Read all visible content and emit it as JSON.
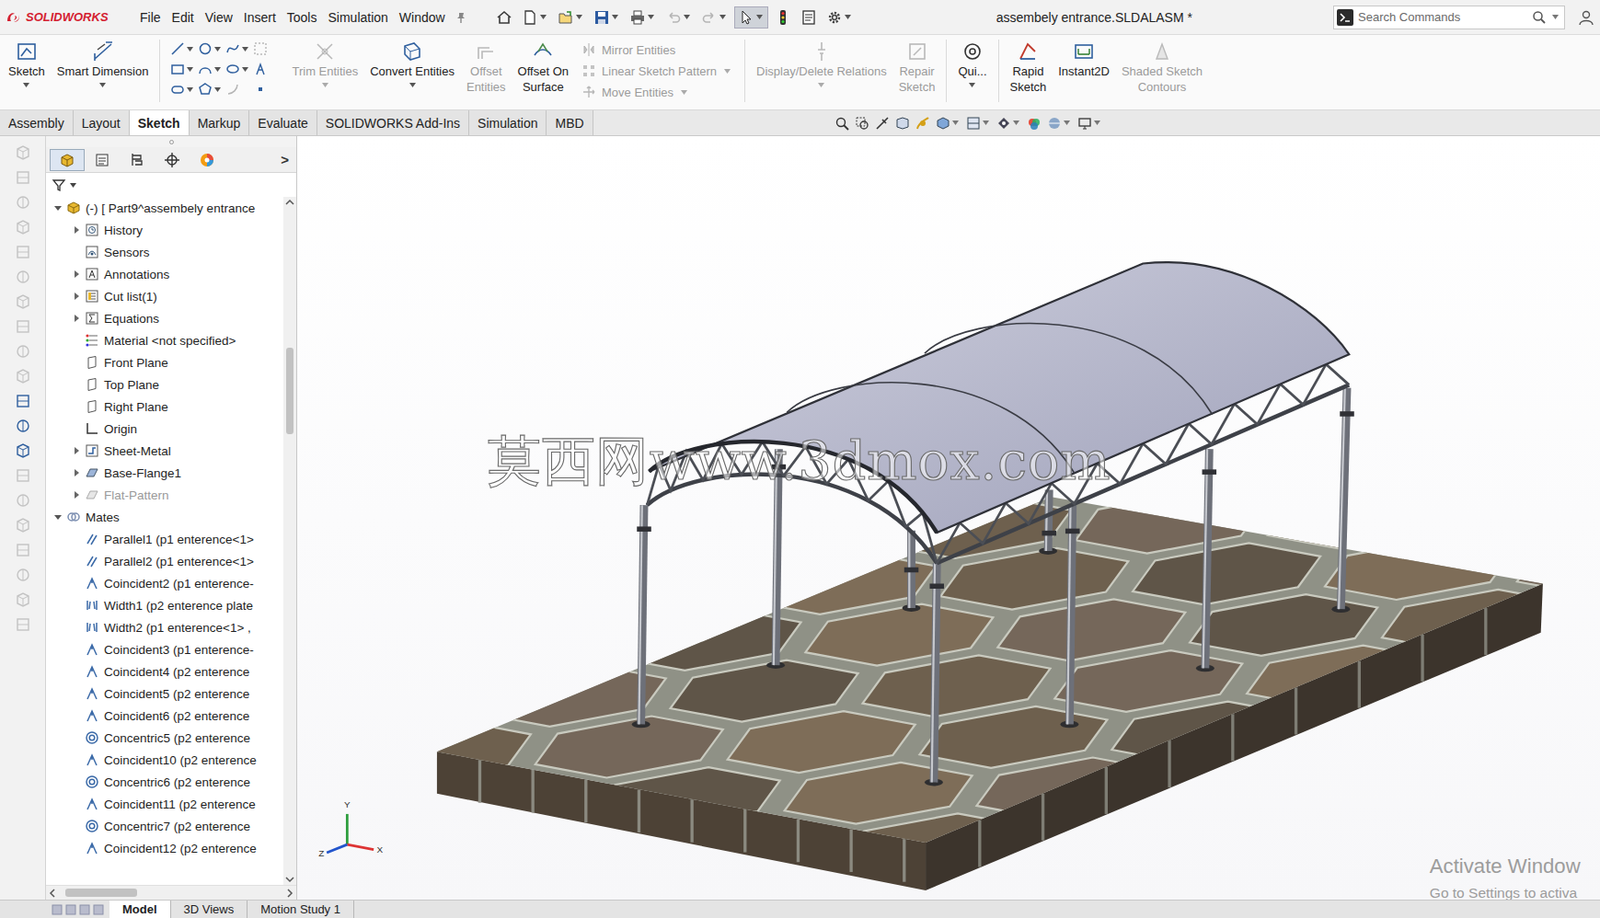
{
  "app": {
    "name": "SOLIDWORKS"
  },
  "menu": [
    "File",
    "Edit",
    "View",
    "Insert",
    "Tools",
    "Simulation",
    "Window"
  ],
  "window": {
    "title": "assembely entrance.SLDALASM *"
  },
  "search": {
    "placeholder": "Search Commands"
  },
  "ribbon": [
    {
      "kind": "large",
      "label": "Sketch",
      "disabled": false,
      "dropdown": true
    },
    {
      "kind": "large",
      "label": "Smart Dimension",
      "disabled": false,
      "dropdown": true
    },
    {
      "kind": "grid"
    },
    {
      "kind": "large",
      "label": "Trim Entities",
      "disabled": true,
      "dropdown": true
    },
    {
      "kind": "large",
      "label": "Convert Entities",
      "disabled": false,
      "dropdown": true
    },
    {
      "kind": "large",
      "label": "Offset\nEntities",
      "disabled": true,
      "dropdown": false
    },
    {
      "kind": "large",
      "label": "Offset On\nSurface",
      "disabled": false,
      "dropdown": false
    },
    {
      "kind": "list",
      "items": [
        {
          "label": "Mirror Entities",
          "disabled": true
        },
        {
          "label": "Linear Sketch Pattern",
          "disabled": true
        },
        {
          "label": "Move Entities",
          "disabled": true
        }
      ]
    },
    {
      "kind": "large",
      "label": "Display/Delete Relations",
      "disabled": true,
      "dropdown": true
    },
    {
      "kind": "large",
      "label": "Repair\nSketch",
      "disabled": true,
      "dropdown": false
    },
    {
      "kind": "large",
      "label": "Qui...",
      "disabled": false,
      "dropdown": true
    },
    {
      "kind": "large",
      "label": "Rapid\nSketch",
      "disabled": false,
      "dropdown": false
    },
    {
      "kind": "large",
      "label": "Instant2D",
      "disabled": false,
      "dropdown": false
    },
    {
      "kind": "large",
      "label": "Shaded Sketch\nContours",
      "disabled": true,
      "dropdown": false
    }
  ],
  "tabs": [
    {
      "label": "Assembly",
      "selected": false
    },
    {
      "label": "Layout",
      "selected": false
    },
    {
      "label": "Sketch",
      "selected": true
    },
    {
      "label": "Markup",
      "selected": false
    },
    {
      "label": "Evaluate",
      "selected": false
    },
    {
      "label": "SOLIDWORKS Add-Ins",
      "selected": false
    },
    {
      "label": "Simulation",
      "selected": false
    },
    {
      "label": "MBD",
      "selected": false
    }
  ],
  "left_toolbar": [
    {
      "disabled": true
    },
    {
      "disabled": true
    },
    {
      "disabled": true
    },
    {
      "disabled": true
    },
    {
      "disabled": true
    },
    {
      "disabled": true
    },
    {
      "disabled": true
    },
    {
      "disabled": true
    },
    {
      "disabled": true
    },
    {
      "disabled": true
    },
    {
      "disabled": false
    },
    {
      "disabled": false
    },
    {
      "disabled": false
    },
    {
      "disabled": true
    },
    {
      "disabled": true
    },
    {
      "disabled": true
    },
    {
      "disabled": true
    },
    {
      "disabled": true
    },
    {
      "disabled": true
    },
    {
      "disabled": true
    }
  ],
  "panel_tabs": [
    {
      "selected": true
    },
    {
      "selected": false
    },
    {
      "selected": false
    },
    {
      "selected": false
    },
    {
      "selected": false
    }
  ],
  "panel_more": ">",
  "tree": {
    "items": [
      {
        "label": "(-) [ Part9^assembely entrance",
        "level": 0,
        "kind": "part",
        "expandable": true,
        "expanded": true,
        "disabled": false
      },
      {
        "label": "History",
        "level": 1,
        "kind": "history",
        "expandable": true,
        "expanded": false,
        "disabled": false
      },
      {
        "label": "Sensors",
        "level": 1,
        "kind": "sensors",
        "expandable": false,
        "expanded": false,
        "disabled": false
      },
      {
        "label": "Annotations",
        "level": 1,
        "kind": "annotations",
        "expandable": true,
        "expanded": false,
        "disabled": false
      },
      {
        "label": "Cut list(1)",
        "level": 1,
        "kind": "cutlist",
        "expandable": true,
        "expanded": false,
        "disabled": false
      },
      {
        "label": "Equations",
        "level": 1,
        "kind": "equations",
        "expandable": true,
        "expanded": false,
        "disabled": false
      },
      {
        "label": "Material <not specified>",
        "level": 1,
        "kind": "material",
        "expandable": false,
        "expanded": false,
        "disabled": false
      },
      {
        "label": "Front Plane",
        "level": 1,
        "kind": "plane",
        "expandable": false,
        "expanded": false,
        "disabled": false
      },
      {
        "label": "Top Plane",
        "level": 1,
        "kind": "plane",
        "expandable": false,
        "expanded": false,
        "disabled": false
      },
      {
        "label": "Right Plane",
        "level": 1,
        "kind": "plane",
        "expandable": false,
        "expanded": false,
        "disabled": false
      },
      {
        "label": "Origin",
        "level": 1,
        "kind": "origin",
        "expandable": false,
        "expanded": false,
        "disabled": false
      },
      {
        "label": "Sheet-Metal",
        "level": 1,
        "kind": "sheetmetal",
        "expandable": true,
        "expanded": false,
        "disabled": false
      },
      {
        "label": "Base-Flange1",
        "level": 1,
        "kind": "feature",
        "expandable": true,
        "expanded": false,
        "disabled": false
      },
      {
        "label": "Flat-Pattern",
        "level": 1,
        "kind": "flatpattern",
        "expandable": true,
        "expanded": false,
        "disabled": true
      },
      {
        "label": "Mates",
        "level": 0,
        "kind": "mates",
        "expandable": true,
        "expanded": true,
        "disabled": false
      },
      {
        "label": "Parallel1 (p1 enterence<1>",
        "level": 1,
        "kind": "parallel",
        "expandable": false,
        "expanded": false,
        "disabled": false
      },
      {
        "label": "Parallel2 (p1 enterence<1>",
        "level": 1,
        "kind": "parallel",
        "expandable": false,
        "expanded": false,
        "disabled": false
      },
      {
        "label": "Coincident2 (p1 enterence-",
        "level": 1,
        "kind": "coincident",
        "expandable": false,
        "expanded": false,
        "disabled": false
      },
      {
        "label": "Width1 (p2 enterence plate",
        "level": 1,
        "kind": "width",
        "expandable": false,
        "expanded": false,
        "disabled": false
      },
      {
        "label": "Width2 (p1 enterence<1> ,",
        "level": 1,
        "kind": "width",
        "expandable": false,
        "expanded": false,
        "disabled": false
      },
      {
        "label": "Coincident3 (p1 enterence-",
        "level": 1,
        "kind": "coincident",
        "expandable": false,
        "expanded": false,
        "disabled": false
      },
      {
        "label": "Coincident4 (p2 enterence",
        "level": 1,
        "kind": "coincident",
        "expandable": false,
        "expanded": false,
        "disabled": false
      },
      {
        "label": "Coincident5 (p2 enterence",
        "level": 1,
        "kind": "coincident",
        "expandable": false,
        "expanded": false,
        "disabled": false
      },
      {
        "label": "Coincident6 (p2 enterence",
        "level": 1,
        "kind": "coincident",
        "expandable": false,
        "expanded": false,
        "disabled": false
      },
      {
        "label": "Concentric5 (p2 enterence",
        "level": 1,
        "kind": "concentric",
        "expandable": false,
        "expanded": false,
        "disabled": false
      },
      {
        "label": "Coincident10 (p2 enterence",
        "level": 1,
        "kind": "coincident",
        "expandable": false,
        "expanded": false,
        "disabled": false
      },
      {
        "label": "Concentric6 (p2 enterence",
        "level": 1,
        "kind": "concentric",
        "expandable": false,
        "expanded": false,
        "disabled": false
      },
      {
        "label": "Coincident11 (p2 enterence",
        "level": 1,
        "kind": "coincident",
        "expandable": false,
        "expanded": false,
        "disabled": false
      },
      {
        "label": "Concentric7 (p2 enterence",
        "level": 1,
        "kind": "concentric",
        "expandable": false,
        "expanded": false,
        "disabled": false
      },
      {
        "label": "Coincident12 (p2 enterence",
        "level": 1,
        "kind": "coincident",
        "expandable": false,
        "expanded": false,
        "disabled": false
      }
    ],
    "vscroll": {
      "offset": 0.21,
      "size": 0.13
    },
    "hscroll": {
      "offset": 0.03,
      "size": 0.32
    }
  },
  "bottom_tabs": [
    {
      "label": "Model",
      "selected": true
    },
    {
      "label": "3D Views",
      "selected": false
    },
    {
      "label": "Motion Study 1",
      "selected": false
    }
  ],
  "viewport": {
    "watermark": "莫西网www.3dmox.com",
    "activation": [
      "Activate Window",
      "Go to Settings to activa"
    ],
    "triad": [
      "Y",
      "X",
      "Z"
    ]
  }
}
